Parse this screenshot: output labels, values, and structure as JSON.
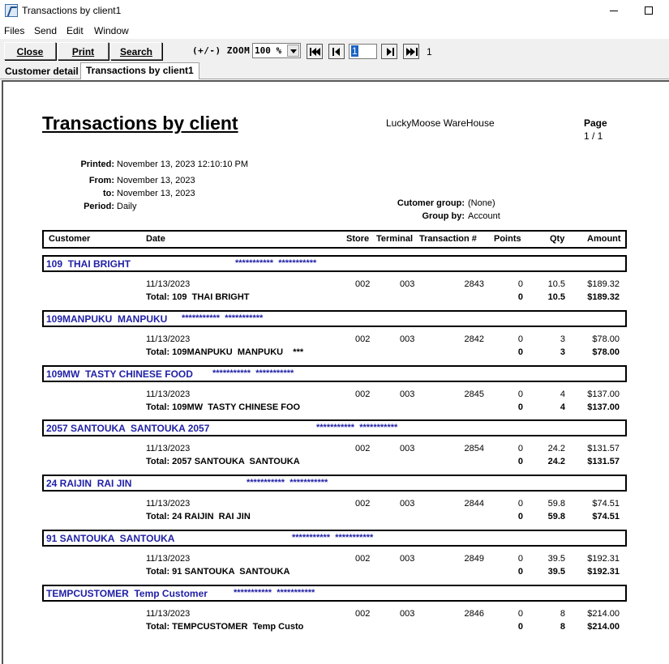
{
  "window": {
    "title": "Transactions by client1"
  },
  "menu": [
    "Files",
    "Send",
    "Edit",
    "Window"
  ],
  "toolbar": {
    "close": "Close",
    "print": "Print",
    "search": "Search",
    "zoom_label": "(+/-) ZOOM",
    "zoom_value": "100 %",
    "page_input": "1",
    "page_total": "1"
  },
  "tabs": [
    "Customer detail",
    "Transactions by client1"
  ],
  "report": {
    "title": "Transactions by client",
    "company": "LuckyMoose WareHouse",
    "page_label": "Page",
    "page_value": "1 / 1",
    "meta": {
      "printed_label": "Printed:",
      "printed": "November 13, 2023 12:10:10 PM",
      "from_label": "From:",
      "from": "November 13, 2023",
      "to_label": "to:",
      "to": "November 13, 2023",
      "period_label": "Period:",
      "period": "Daily",
      "group_label": "Cutomer group:",
      "group": "(None)",
      "groupby_label": "Group by:",
      "groupby": "Account"
    },
    "columns": [
      "Customer",
      "Date",
      "Store",
      "Terminal",
      "Transaction #",
      "Points",
      "Qty",
      "Amount"
    ],
    "groups": [
      {
        "name": "109  THAI BRIGHT",
        "mask": "***********  ***********",
        "row": {
          "date": "11/13/2023",
          "store": "002",
          "terminal": "003",
          "transaction": "2843",
          "points": "0",
          "qty": "10.5",
          "amount": "$189.32"
        },
        "total": {
          "label": "Total: 109  THAI BRIGHT",
          "points": "0",
          "qty": "10.5",
          "amount": "$189.32"
        }
      },
      {
        "name": "109MANPUKU  MANPUKU",
        "mask": "***********  ***********",
        "row": {
          "date": "11/13/2023",
          "store": "002",
          "terminal": "003",
          "transaction": "2842",
          "points": "0",
          "qty": "3",
          "amount": "$78.00"
        },
        "total": {
          "label": "Total: 109MANPUKU  MANPUKU    ***",
          "points": "0",
          "qty": "3",
          "amount": "$78.00"
        }
      },
      {
        "name": "109MW  TASTY CHINESE FOOD",
        "mask": "***********  ***********",
        "row": {
          "date": "11/13/2023",
          "store": "002",
          "terminal": "003",
          "transaction": "2845",
          "points": "0",
          "qty": "4",
          "amount": "$137.00"
        },
        "total": {
          "label": "Total: 109MW  TASTY CHINESE FOO",
          "points": "0",
          "qty": "4",
          "amount": "$137.00"
        }
      },
      {
        "name": "2057 SANTOUKA  SANTOUKA 2057",
        "mask": "***********  ***********",
        "row": {
          "date": "11/13/2023",
          "store": "002",
          "terminal": "003",
          "transaction": "2854",
          "points": "0",
          "qty": "24.2",
          "amount": "$131.57"
        },
        "total": {
          "label": "Total: 2057 SANTOUKA  SANTOUKA",
          "points": "0",
          "qty": "24.2",
          "amount": "$131.57"
        }
      },
      {
        "name": "24 RAIJIN  RAI JIN",
        "mask": "***********  ***********",
        "row": {
          "date": "11/13/2023",
          "store": "002",
          "terminal": "003",
          "transaction": "2844",
          "points": "0",
          "qty": "59.8",
          "amount": "$74.51"
        },
        "total": {
          "label": "Total: 24 RAIJIN  RAI JIN",
          "points": "0",
          "qty": "59.8",
          "amount": "$74.51"
        }
      },
      {
        "name": "91 SANTOUKA  SANTOUKA",
        "mask": "***********  ***********",
        "row": {
          "date": "11/13/2023",
          "store": "002",
          "terminal": "003",
          "transaction": "2849",
          "points": "0",
          "qty": "39.5",
          "amount": "$192.31"
        },
        "total": {
          "label": "Total: 91 SANTOUKA  SANTOUKA",
          "points": "0",
          "qty": "39.5",
          "amount": "$192.31"
        }
      },
      {
        "name": "TEMPCUSTOMER  Temp Customer",
        "mask": "***********  ***********",
        "row": {
          "date": "11/13/2023",
          "store": "002",
          "terminal": "003",
          "transaction": "2846",
          "points": "0",
          "qty": "8",
          "amount": "$214.00"
        },
        "total": {
          "label": "Total: TEMPCUSTOMER  Temp Custo",
          "points": "0",
          "qty": "8",
          "amount": "$214.00"
        }
      }
    ]
  }
}
